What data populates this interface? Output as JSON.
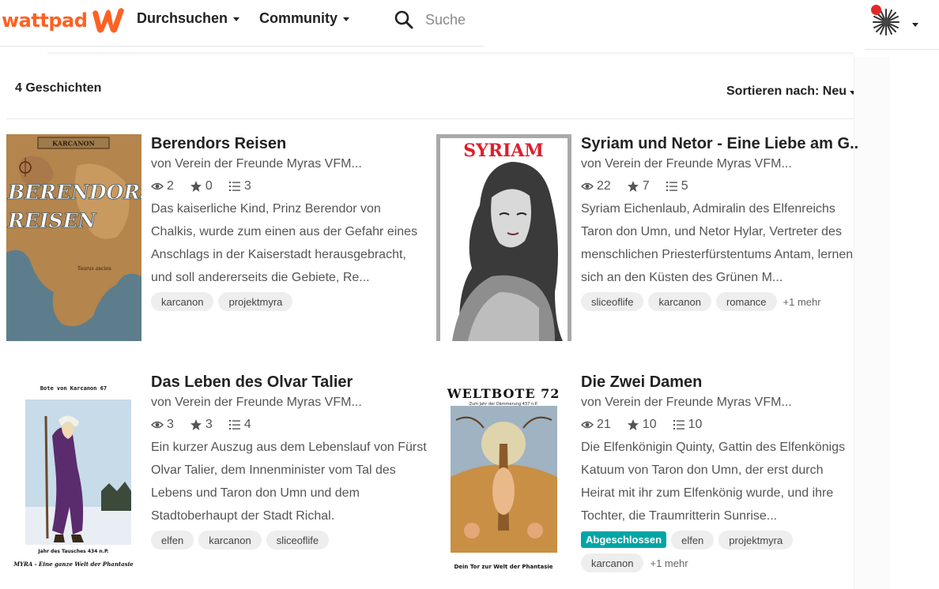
{
  "header": {
    "logo_text": "wattpad",
    "nav": [
      {
        "label": "Durchsuchen"
      },
      {
        "label": "Community"
      }
    ],
    "search_placeholder": "Suche"
  },
  "results": {
    "count_label": "4 Geschichten",
    "sort_label": "Sortieren nach: Neu"
  },
  "stories": [
    {
      "title": "Berendors Reisen",
      "author": "von Verein der Freunde Myras VFM...",
      "reads": "2",
      "votes": "0",
      "parts": "3",
      "description": "Das kaiserliche Kind, Prinz Berendor von Chalkis, wurde zum einen aus der Gefahr eines Anschlags in der Kaiserstadt herausgebracht, und soll andererseits die Gebiete, Re...",
      "tags": [
        "karcanon",
        "projektmyra"
      ],
      "complete_label": "",
      "more_label": "",
      "cover": {
        "top_text": "KARCANON",
        "title_line1": "BERENDORS",
        "title_line2": "REISEN",
        "sub_text": "Taurus ancien",
        "map_color": "#b4854d",
        "sea_color": "#5d7d8c"
      }
    },
    {
      "title": "Syriam und Netor - Eine Liebe am G...",
      "author": "von Verein der Freunde Myras VFM...",
      "reads": "22",
      "votes": "7",
      "parts": "5",
      "description": "Syriam Eichenlaub, Admiralin des Elfenreichs Taron don Umn, und Netor Hylar, Vertreter des menschlichen Priesterfürstentums Antam, lernen sich an den Küsten des Grünen M...",
      "tags": [
        "sliceoflife",
        "karcanon",
        "romance"
      ],
      "complete_label": "",
      "more_label": "+1 mehr",
      "cover": {
        "title_text": "SYRIAM"
      }
    },
    {
      "title": "Das Leben des Olvar Talier",
      "author": "von Verein der Freunde Myras VFM...",
      "reads": "3",
      "votes": "3",
      "parts": "4",
      "description": "Ein kurzer Auszug aus dem Lebenslauf von Fürst Olvar Talier, dem Innenminister vom Tal des Lebens und Taron don Umn und dem Stadtoberhaupt der Stadt Richal.",
      "tags": [
        "elfen",
        "karcanon",
        "sliceoflife"
      ],
      "complete_label": "",
      "more_label": "",
      "cover": {
        "top_text": "Bote von Karcanon 67",
        "bottom_text": "Jahr des Tausches 434 n.P.",
        "footer_text": "MYRA - Eine ganze Welt der Phantasie"
      }
    },
    {
      "title": "Die Zwei Damen",
      "author": "von Verein der Freunde Myras VFM...",
      "reads": "21",
      "votes": "10",
      "parts": "10",
      "description": "Die Elfenkönigin Quinty, Gattin des Elfenkönigs Katuum von Taron don Umn, der erst durch Heirat mit ihr zum Elfenkönig wurde, und ihre Tochter, die Traumritterin Sunrise...",
      "tags": [
        "elfen",
        "projektmyra",
        "karcanon"
      ],
      "complete_label": "Abgeschlossen",
      "more_label": "+1 mehr",
      "cover": {
        "title_text": "WELTBOTE 72",
        "sub_text": "Zum Jahr der Dämmerung 437 n.P.",
        "footer_text": "Dein Tor zur Welt der Phantasie"
      }
    }
  ],
  "colors": {
    "brand": "#ff6122",
    "complete_badge": "#00a6a6",
    "notification": "#e02a2a"
  },
  "icons": {
    "reads": "eye-icon",
    "votes": "star-icon",
    "parts": "list-icon",
    "search": "search-icon"
  }
}
